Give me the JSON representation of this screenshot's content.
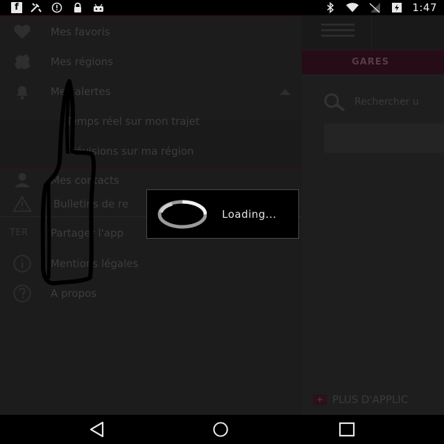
{
  "status_bar": {
    "left_icons": [
      "facebook-icon",
      "tools-icon",
      "alert-circle-icon",
      "lock-icon",
      "android-icon"
    ],
    "right_icons": [
      "bluetooth-icon",
      "wifi-icon",
      "no-signal-icon",
      "battery-charging-icon"
    ],
    "time": "1:47",
    "facebook_glyph": "f"
  },
  "drawer": {
    "items": [
      {
        "label": "Mes favoris",
        "icon": "heart-icon"
      },
      {
        "label": "Mes régions",
        "icon": "map-region-icon"
      },
      {
        "label": "Mes alertes",
        "icon": "bell-icon",
        "expanded": true
      },
      {
        "label": "Temps réel sur mon trajet",
        "icon": ""
      },
      {
        "label": "Prévisions sur ma région",
        "icon": ""
      },
      {
        "label": "Mes contacts",
        "icon": "person-icon"
      },
      {
        "label": "Bulletins de re",
        "icon": "warning-icon"
      },
      {
        "label": "Partager l'app",
        "icon": "ter-logo"
      },
      {
        "label": "Mentions légales",
        "icon": "info-icon"
      },
      {
        "label": "A propos",
        "icon": "help-icon"
      }
    ],
    "ter_label": "TER"
  },
  "main": {
    "tab_label": "GARES",
    "search_placeholder": "Rechercher u",
    "more_apps_label": "PLUS D'APPLIC"
  },
  "loading": {
    "text": "Loading..."
  },
  "colors": {
    "accent": "#2a1020",
    "dialog_bg": "#000000",
    "dim_text": "#3d3d3d"
  }
}
